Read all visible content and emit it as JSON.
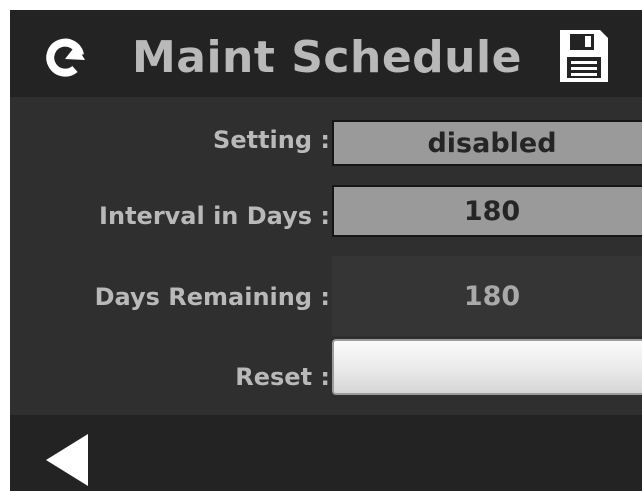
{
  "header": {
    "title": "Maint Schedule",
    "refresh_icon": "refresh-icon",
    "save_icon": "save-icon"
  },
  "rows": {
    "setting": {
      "label": "Setting :",
      "value": "disabled"
    },
    "interval": {
      "label": "Interval in Days :",
      "value": "180"
    },
    "remaining": {
      "label": "Days Remaining :",
      "value": "180"
    },
    "reset": {
      "label": "Reset :",
      "value": ""
    }
  },
  "footer": {
    "back_icon": "back-arrow-icon"
  },
  "colors": {
    "background": "#2f2f2f",
    "bar": "#232323",
    "text": "#b9b9b9",
    "editable_box": "#9a9a9a",
    "button": "#f0f0f0"
  }
}
